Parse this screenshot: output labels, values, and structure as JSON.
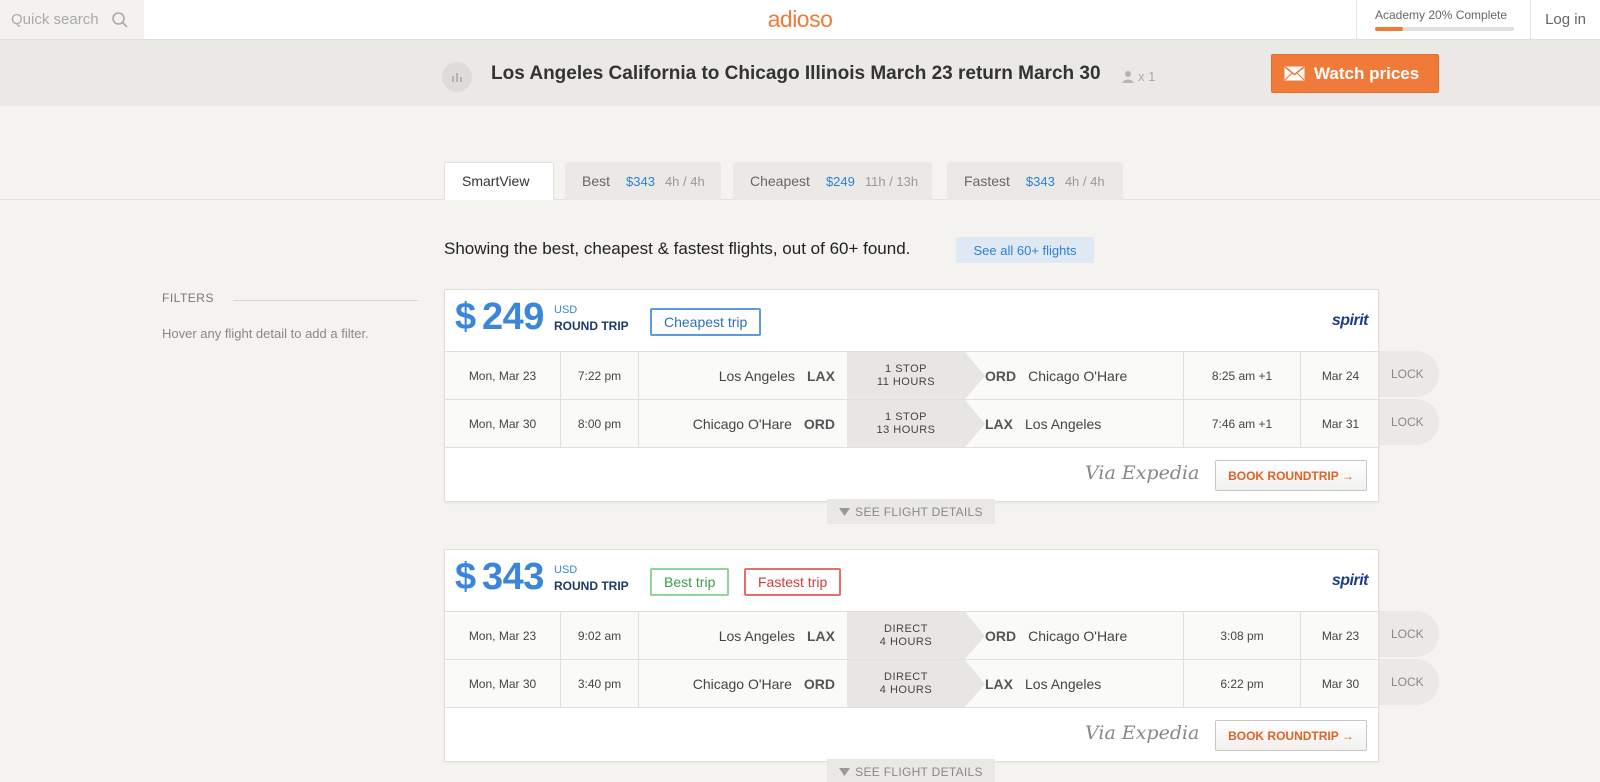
{
  "topbar": {
    "quick_search_placeholder": "Quick search",
    "logo": "adioso",
    "academy_label": "Academy 20% Complete",
    "academy_progress": 0.2,
    "login": "Log in"
  },
  "summary": {
    "title": "Los Angeles California to Chicago Illinois March 23 return March 30",
    "passengers": "x 1",
    "watch_label": "Watch prices"
  },
  "tabs": [
    {
      "label": "SmartView",
      "price": "",
      "duration": ""
    },
    {
      "label": "Best",
      "price": "$343",
      "duration": "4h / 4h"
    },
    {
      "label": "Cheapest",
      "price": "$249",
      "duration": "11h / 13h"
    },
    {
      "label": "Fastest",
      "price": "$343",
      "duration": "4h / 4h"
    }
  ],
  "results": {
    "showing_text": "Showing the best, cheapest & fastest flights, out of 60+ found.",
    "see_all": "See all 60+ flights"
  },
  "filters": {
    "title": "FILTERS",
    "hint": "Hover any flight detail to add a filter."
  },
  "flights": [
    {
      "currency_symbol": "$",
      "price": "249",
      "currency": "USD",
      "trip_type": "ROUND TRIP",
      "badges": [
        "Cheapest trip"
      ],
      "airline": "spirit",
      "legs": [
        {
          "date": "Mon, Mar 23",
          "time": "7:22 pm",
          "from_city": "Los Angeles",
          "from_code": "LAX",
          "stops": "1 STOP",
          "duration": "11 HOURS",
          "to_code": "ORD",
          "to_city": "Chicago O'Hare",
          "arrive_time": "8:25 am +1",
          "arrive_date": "Mar 24",
          "lock": "LOCK"
        },
        {
          "date": "Mon, Mar 30",
          "time": "8:00 pm",
          "from_city": "Chicago O'Hare",
          "from_code": "ORD",
          "stops": "1 STOP",
          "duration": "13 HOURS",
          "to_code": "LAX",
          "to_city": "Los Angeles",
          "arrive_time": "7:46 am +1",
          "arrive_date": "Mar 31",
          "lock": "LOCK"
        }
      ],
      "via": "Via Expedia",
      "book_label": "BOOK ROUNDTRIP →",
      "details_label": "SEE FLIGHT DETAILS"
    },
    {
      "currency_symbol": "$",
      "price": "343",
      "currency": "USD",
      "trip_type": "ROUND TRIP",
      "badges": [
        "Best trip",
        "Fastest trip"
      ],
      "airline": "spirit",
      "legs": [
        {
          "date": "Mon, Mar 23",
          "time": "9:02 am",
          "from_city": "Los Angeles",
          "from_code": "LAX",
          "stops": "DIRECT",
          "duration": "4 HOURS",
          "to_code": "ORD",
          "to_city": "Chicago O'Hare",
          "arrive_time": "3:08 pm",
          "arrive_date": "Mar 23",
          "lock": "LOCK"
        },
        {
          "date": "Mon, Mar 30",
          "time": "3:40 pm",
          "from_city": "Chicago O'Hare",
          "from_code": "ORD",
          "stops": "DIRECT",
          "duration": "4 HOURS",
          "to_code": "LAX",
          "to_city": "Los Angeles",
          "arrive_time": "6:22 pm",
          "arrive_date": "Mar 30",
          "lock": "LOCK"
        }
      ],
      "via": "Via Expedia",
      "book_label": "BOOK ROUNDTRIP →",
      "details_label": "SEE FLIGHT DETAILS"
    }
  ],
  "colors": {
    "accent": "#f07a3a",
    "price_blue": "#3b86db",
    "airline_navy": "#1e3e8a"
  }
}
